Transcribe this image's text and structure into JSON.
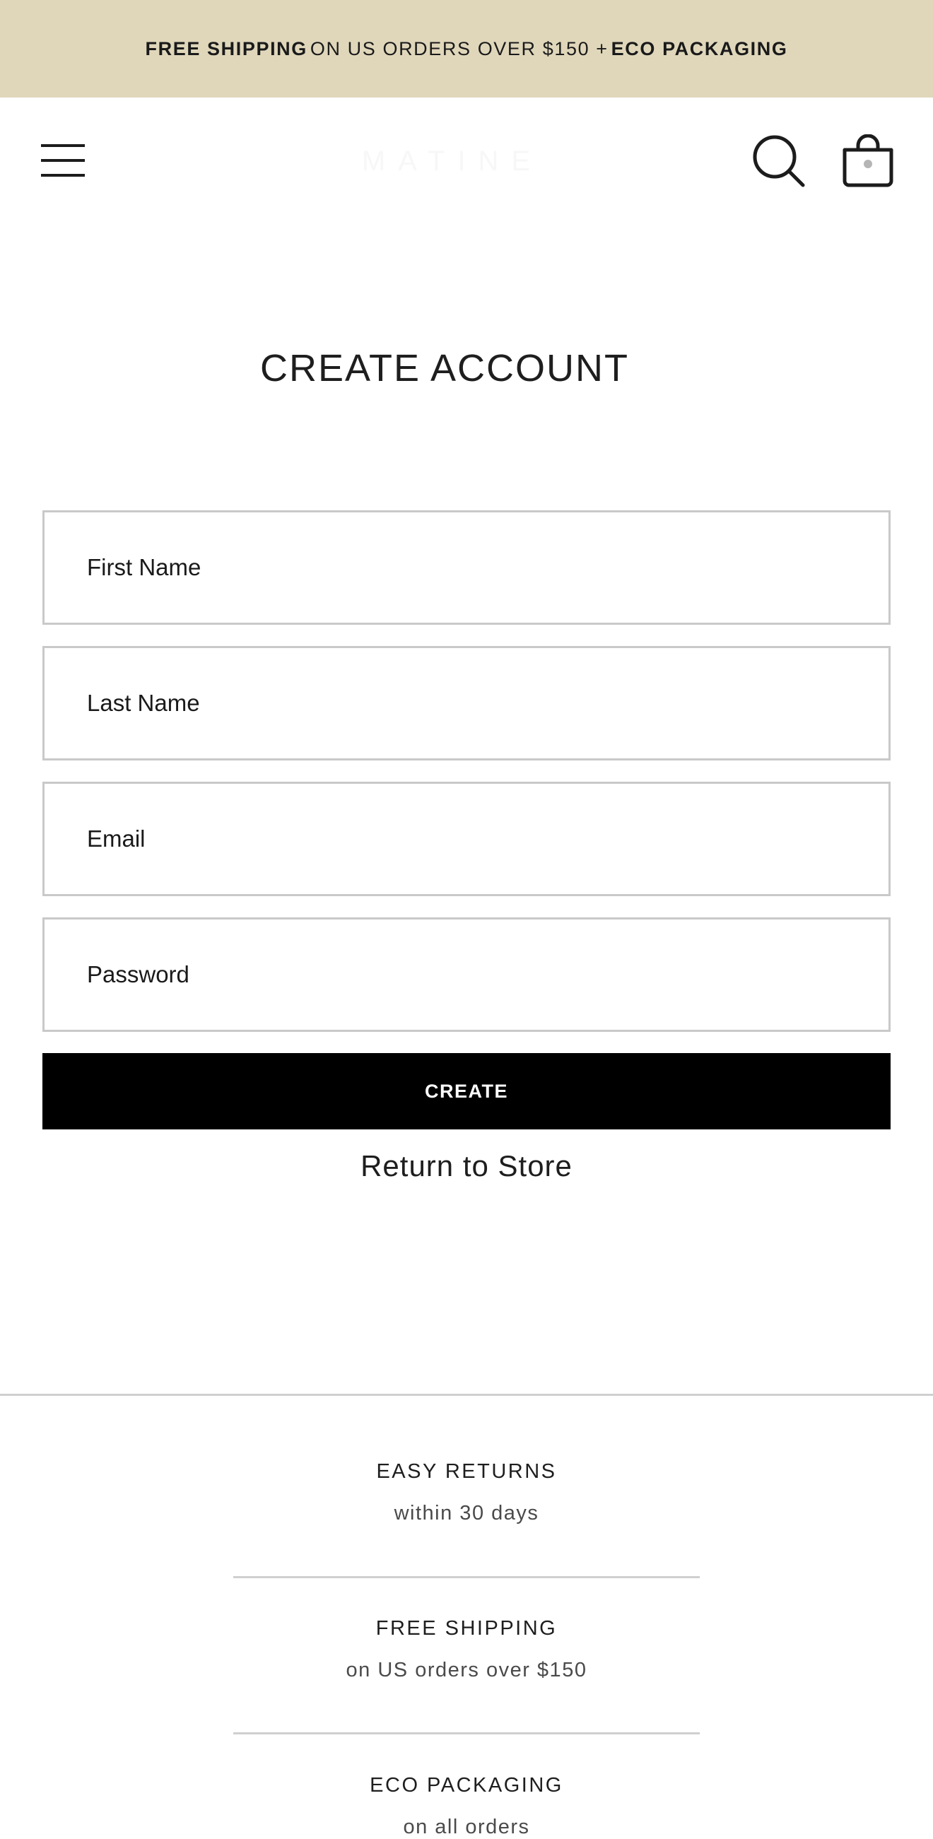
{
  "announcement": {
    "part1": "FREE SHIPPING",
    "part2": "ON US ORDERS OVER $150 +",
    "part3": "ECO PACKAGING"
  },
  "header": {
    "logo_text": "MATINE",
    "icons": [
      "menu-icon",
      "search-icon",
      "cart-icon"
    ]
  },
  "page": {
    "title": "CREATE ACCOUNT"
  },
  "form": {
    "first_name_placeholder": "First Name",
    "last_name_placeholder": "Last Name",
    "email_placeholder": "Email",
    "password_placeholder": "Password",
    "submit_label": "CREATE",
    "return_label": "Return to Store"
  },
  "footer": {
    "features": [
      {
        "title": "EASY RETURNS",
        "subtitle": "within 30 days"
      },
      {
        "title": "FREE SHIPPING",
        "subtitle": "on US orders over $150"
      },
      {
        "title": "ECO PACKAGING",
        "subtitle": "on all orders"
      }
    ]
  },
  "colors": {
    "announcement_bg": "#e0d7bb",
    "button_bg": "#000000",
    "border": "#c9c9c9"
  }
}
